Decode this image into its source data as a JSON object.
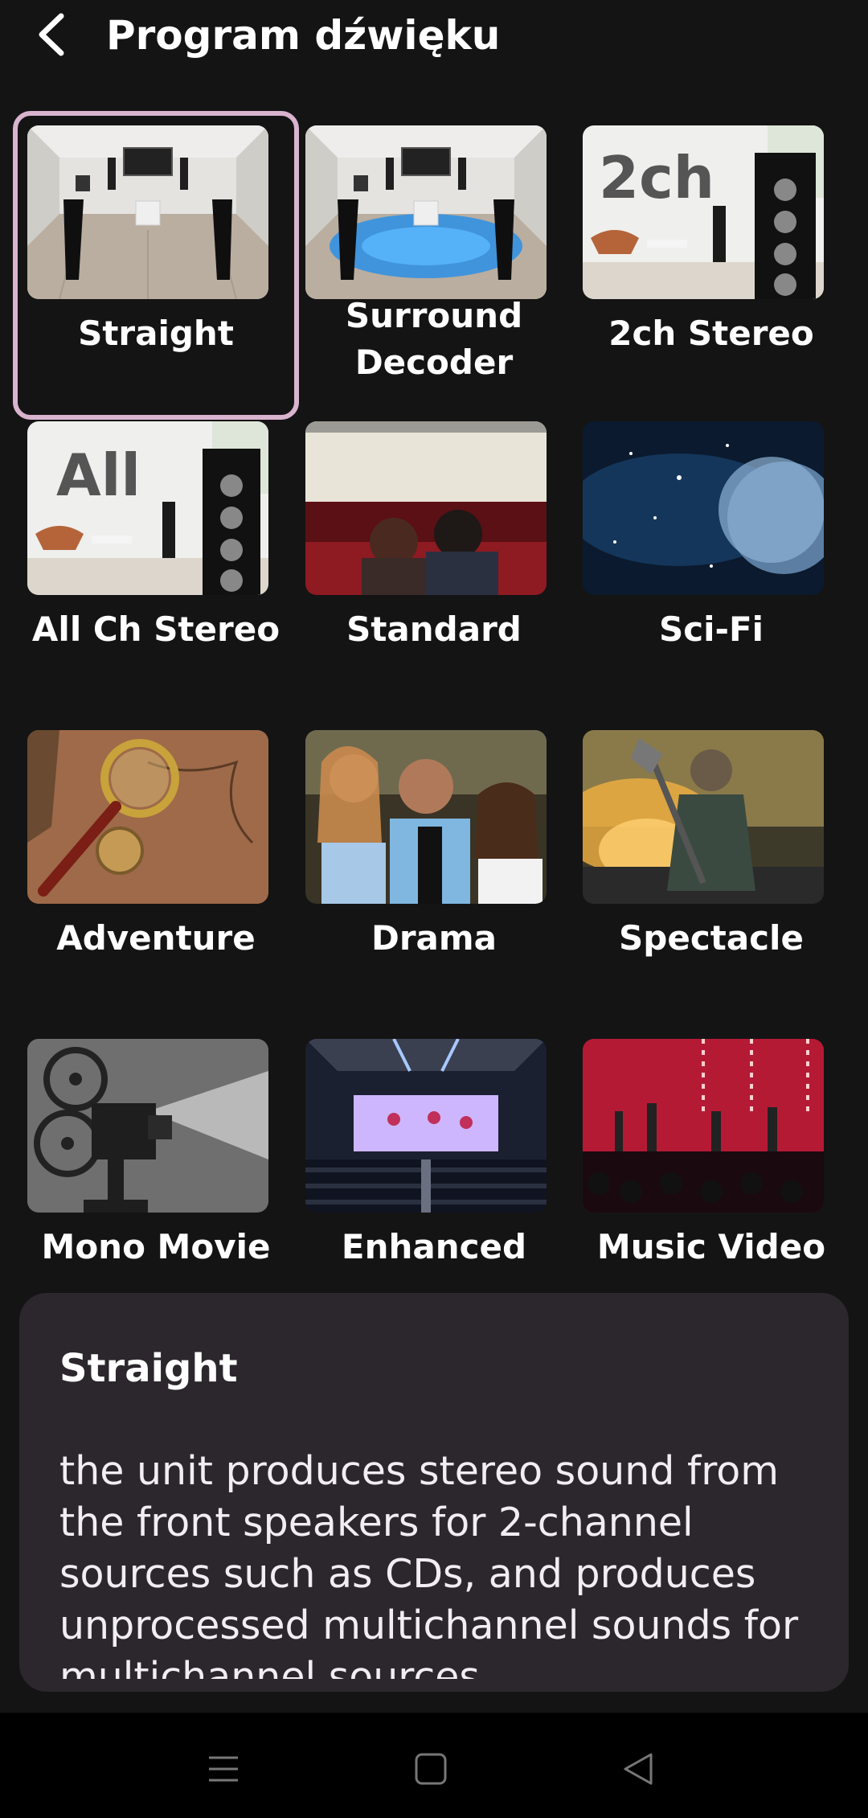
{
  "header": {
    "title": "Program dźwięku",
    "back_icon": "chevron-left-icon"
  },
  "programs": [
    {
      "label": "Straight",
      "selected": true
    },
    {
      "label": "Surround Decoder",
      "selected": false
    },
    {
      "label": "2ch Stereo",
      "selected": false
    },
    {
      "label": "All Ch Stereo",
      "selected": false
    },
    {
      "label": "Standard",
      "selected": false
    },
    {
      "label": "Sci-Fi",
      "selected": false
    },
    {
      "label": "Adventure",
      "selected": false
    },
    {
      "label": "Drama",
      "selected": false
    },
    {
      "label": "Spectacle",
      "selected": false
    },
    {
      "label": "Mono Movie",
      "selected": false
    },
    {
      "label": "Enhanced",
      "selected": false
    },
    {
      "label": "Music Video",
      "selected": false
    }
  ],
  "thumb_text": {
    "two_ch": "2ch",
    "all": "All"
  },
  "info": {
    "title": "Straight",
    "description": "the unit produces stereo sound from the front speakers for 2-channel sources such as CDs, and produces unprocessed multichannel sounds for multichannel sources."
  },
  "navbar": {
    "icons": [
      "menu-icon",
      "home-square-icon",
      "back-triangle-icon"
    ]
  },
  "colors": {
    "background": "#141414",
    "selected_border": "#d9b4cf",
    "panel": "#2b272d",
    "navbar": "#000000"
  }
}
